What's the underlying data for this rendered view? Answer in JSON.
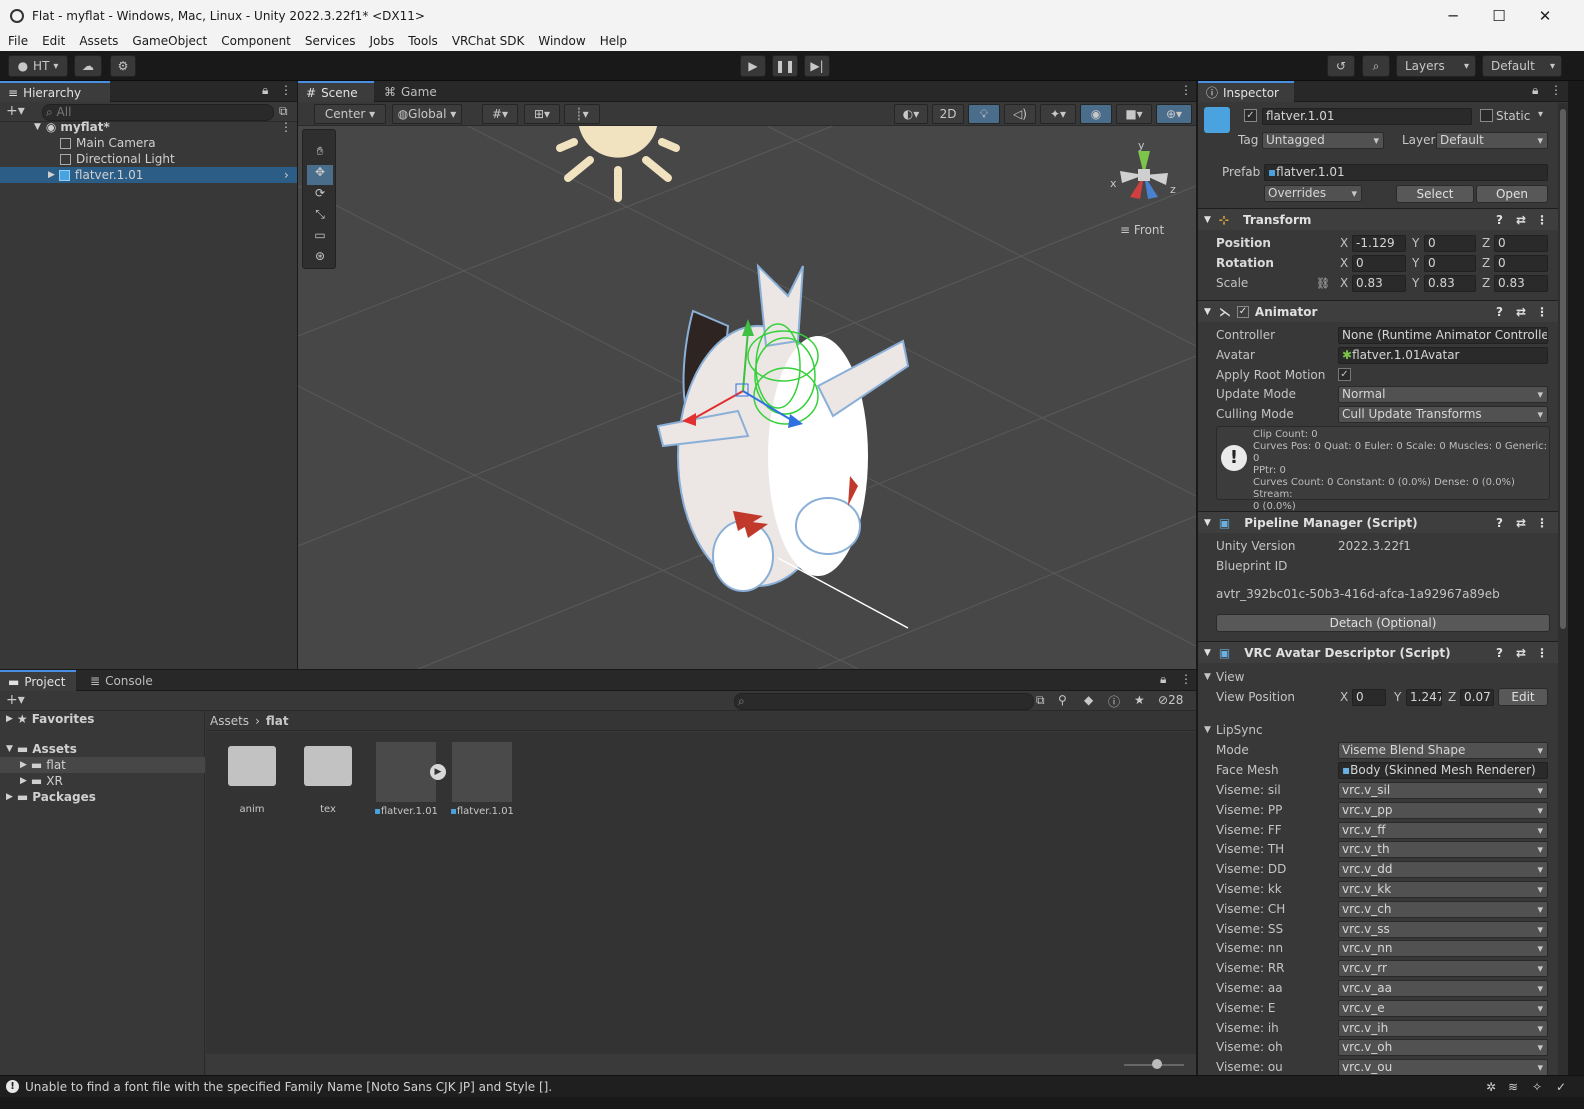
{
  "window": {
    "title": "Flat - myflat - Windows, Mac, Linux - Unity 2022.3.22f1* <DX11>",
    "controls": [
      "─",
      "☐",
      "✕"
    ]
  },
  "menu": [
    "File",
    "Edit",
    "Assets",
    "GameObject",
    "Component",
    "Services",
    "Jobs",
    "Tools",
    "VRChat SDK",
    "Window",
    "Help"
  ],
  "toolbar": {
    "account": "HT",
    "layers": "Layers",
    "layout": "Default"
  },
  "hierarchy": {
    "tab": "Hierarchy",
    "search_placeholder": "All",
    "scene": "myflat*",
    "items": [
      "Main Camera",
      "Directional Light",
      "flatver.1.01"
    ]
  },
  "scene_view": {
    "tabs": [
      "Scene",
      "Game"
    ],
    "pivot": "Center",
    "space": "Global",
    "mode_2d": "2D",
    "gizmo_view": "Front",
    "gizmo_axes": [
      "y",
      "x",
      "z"
    ]
  },
  "inspector": {
    "tab": "Inspector",
    "object_name": "flatver.1.01",
    "static_label": "Static",
    "tag_label": "Tag",
    "tag_value": "Untagged",
    "layer_label": "Layer",
    "layer_value": "Default",
    "prefab_label": "Prefab",
    "prefab_value": "flatver.1.01",
    "overrides": "Overrides",
    "select": "Select",
    "open": "Open",
    "transform": {
      "title": "Transform",
      "position_label": "Position",
      "rotation_label": "Rotation",
      "scale_label": "Scale",
      "position": [
        "-1.129",
        "0",
        "0"
      ],
      "rotation": [
        "0",
        "0",
        "0"
      ],
      "scale": [
        "0.83",
        "0.83",
        "0.83"
      ]
    },
    "animator": {
      "title": "Animator",
      "controller_label": "Controller",
      "controller_value": "None (Runtime Animator Controller)",
      "avatar_label": "Avatar",
      "avatar_value": "flatver.1.01Avatar",
      "apply_root_label": "Apply Root Motion",
      "update_mode_label": "Update Mode",
      "update_mode_value": "Normal",
      "culling_mode_label": "Culling Mode",
      "culling_mode_value": "Cull Update Transforms",
      "info_line1": "Clip Count: 0",
      "info_line2": "Curves Pos: 0 Quat: 0 Euler: 0 Scale: 0 Muscles: 0 Generic: 0",
      "info_line3": "PPtr: 0",
      "info_line4": "Curves Count: 0 Constant: 0 (0.0%) Dense: 0 (0.0%) Stream:",
      "info_line5": "0 (0.0%)"
    },
    "pipeline": {
      "title": "Pipeline Manager (Script)",
      "unity_version_label": "Unity Version",
      "unity_version_value": "2022.3.22f1",
      "blueprint_label": "Blueprint ID",
      "blueprint_value": "avtr_392bc01c-50b3-416d-afca-1a92967a89eb",
      "detach": "Detach (Optional)"
    },
    "vrc": {
      "title": "VRC Avatar Descriptor (Script)",
      "view_section": "View",
      "view_position_label": "View Position",
      "view_position": [
        "0",
        "1.247",
        "0.07"
      ],
      "edit": "Edit",
      "lipsync_section": "LipSync",
      "mode_label": "Mode",
      "mode_value": "Viseme Blend Shape",
      "face_mesh_label": "Face Mesh",
      "face_mesh_value": "Body (Skinned Mesh Renderer)",
      "visemes": [
        {
          "label": "Viseme: sil",
          "value": "vrc.v_sil"
        },
        {
          "label": "Viseme: PP",
          "value": "vrc.v_pp"
        },
        {
          "label": "Viseme: FF",
          "value": "vrc.v_ff"
        },
        {
          "label": "Viseme: TH",
          "value": "vrc.v_th"
        },
        {
          "label": "Viseme: DD",
          "value": "vrc.v_dd"
        },
        {
          "label": "Viseme: kk",
          "value": "vrc.v_kk"
        },
        {
          "label": "Viseme: CH",
          "value": "vrc.v_ch"
        },
        {
          "label": "Viseme: SS",
          "value": "vrc.v_ss"
        },
        {
          "label": "Viseme: nn",
          "value": "vrc.v_nn"
        },
        {
          "label": "Viseme: RR",
          "value": "vrc.v_rr"
        },
        {
          "label": "Viseme: aa",
          "value": "vrc.v_aa"
        },
        {
          "label": "Viseme: E",
          "value": "vrc.v_e"
        },
        {
          "label": "Viseme: ih",
          "value": "vrc.v_ih"
        },
        {
          "label": "Viseme: oh",
          "value": "vrc.v_oh"
        },
        {
          "label": "Viseme: ou",
          "value": "vrc.v_ou"
        }
      ]
    }
  },
  "project": {
    "tabs": [
      "Project",
      "Console"
    ],
    "hidden_count": "28",
    "tree": {
      "favorites": "Favorites",
      "assets": "Assets",
      "flat": "flat",
      "xr": "XR",
      "packages": "Packages"
    },
    "breadcrumb": [
      "Assets",
      "flat"
    ],
    "items": [
      "anim",
      "tex",
      "flatver.1.01",
      "flatver.1.01"
    ]
  },
  "status": {
    "message": "Unable to find a font file with the specified Family Name [Noto Sans CJK JP] and Style []."
  },
  "colors": {
    "accent": "#4a90e2",
    "selection": "#2c5d87",
    "panel": "#383838"
  }
}
